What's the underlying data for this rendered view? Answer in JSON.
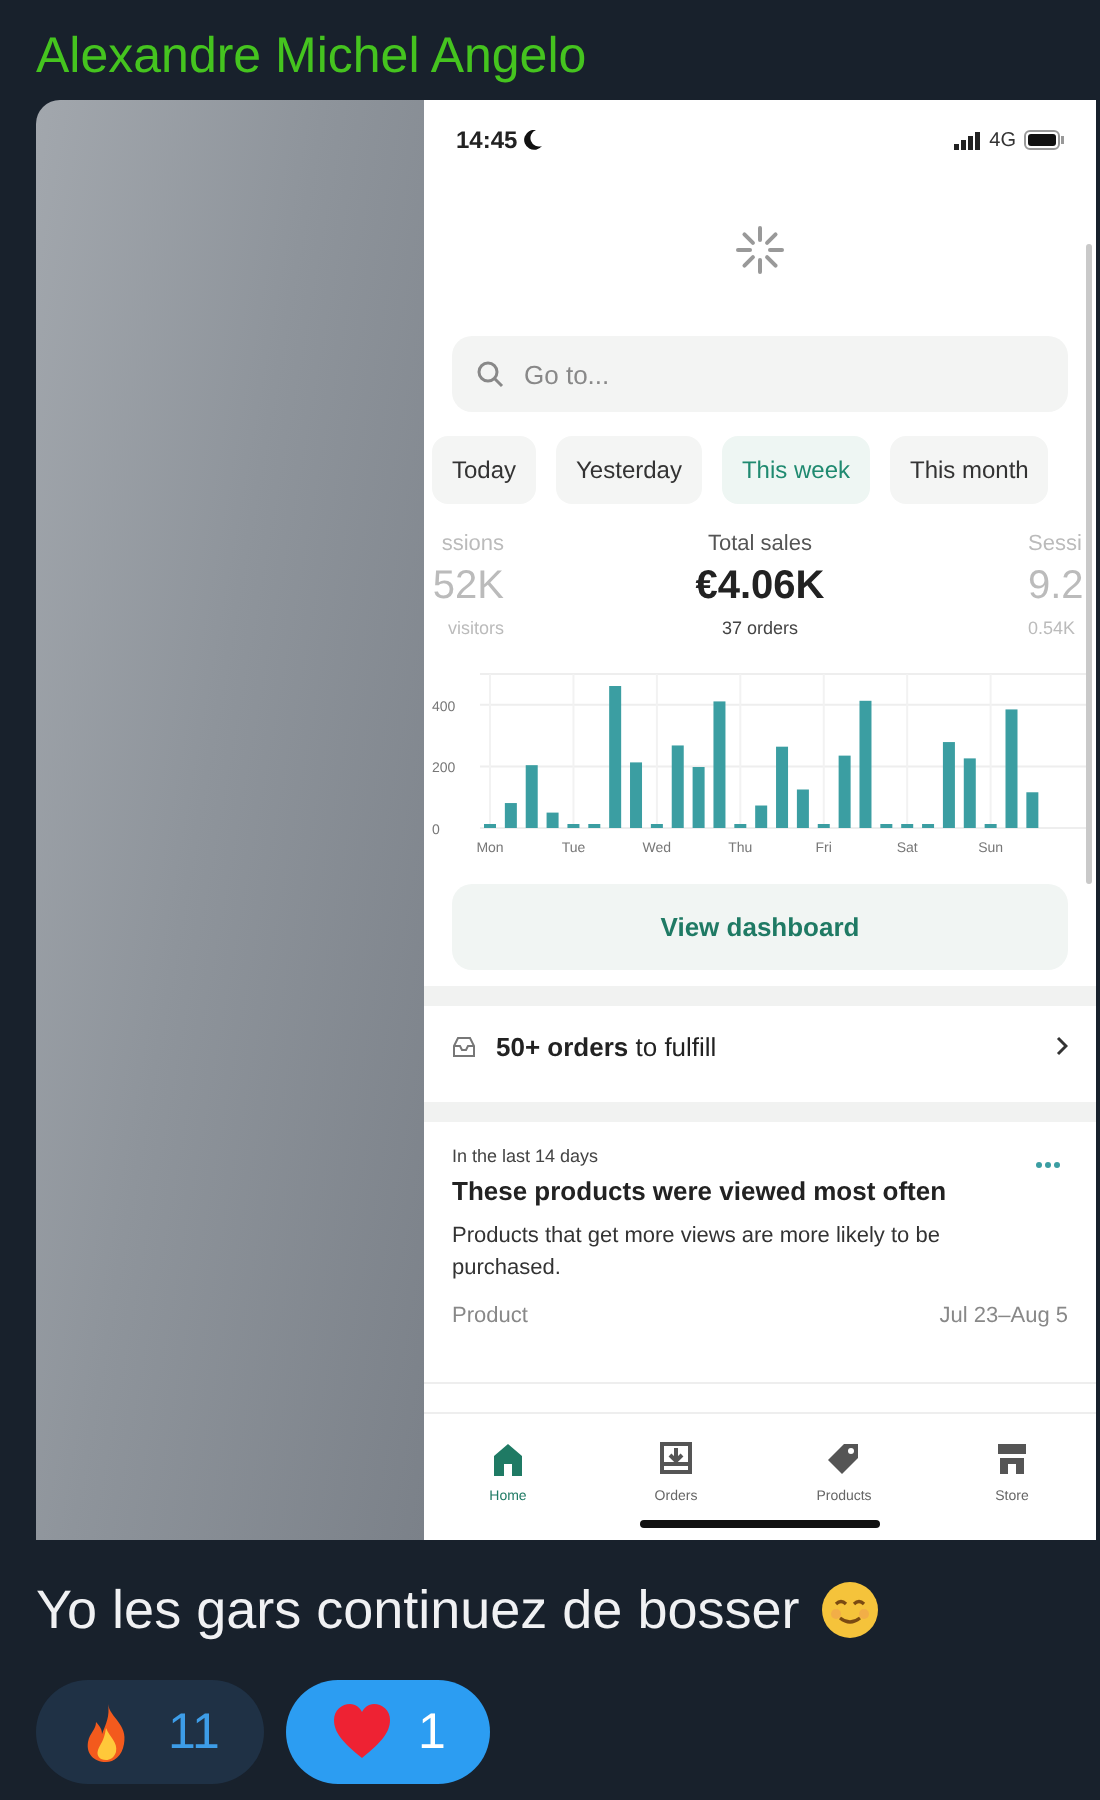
{
  "sender": {
    "name": "Alexandre Michel Angelo"
  },
  "screenshot": {
    "status_bar": {
      "time": "14:45",
      "network": "4G"
    },
    "search": {
      "placeholder": "Go to..."
    },
    "periods": [
      {
        "label": "Today",
        "selected": false
      },
      {
        "label": "Yesterday",
        "selected": false
      },
      {
        "label": "This week",
        "selected": true
      },
      {
        "label": "This month",
        "selected": false
      }
    ],
    "stats": [
      {
        "label": "ssions",
        "value": "52K",
        "detail": "visitors"
      },
      {
        "label": "Total sales",
        "value": "€4.06K",
        "detail": "37 orders"
      },
      {
        "label": "Sessi",
        "value": "9.2",
        "detail": "0.54K"
      }
    ],
    "chart_data": {
      "type": "bar",
      "categories": [
        "Mon",
        null,
        null,
        null,
        "Tue",
        null,
        null,
        null,
        "Wed",
        null,
        null,
        null,
        "Thu",
        null,
        null,
        null,
        "Fri",
        null,
        null,
        null,
        "Sat",
        null,
        null,
        null,
        "Sun",
        null,
        null
      ],
      "values": [
        0,
        81,
        204,
        50,
        0,
        0,
        461,
        213,
        0,
        268,
        198,
        411,
        0,
        73,
        264,
        125,
        0,
        235,
        413,
        0,
        0,
        0,
        279,
        226,
        0,
        385,
        116
      ],
      "ylim": [
        0,
        500
      ],
      "yticks": [
        0,
        200,
        400
      ],
      "grid": true
    },
    "dashboard_button": "View dashboard",
    "orders_row": "**50+ orders** to fulfill",
    "insight": {
      "eyebrow": "In the last 14 days",
      "title": "These products were viewed most often",
      "description": "Products that get more views are more likely to be purchased.",
      "column_1": "Product",
      "column_2": "Jul 23–Aug 5"
    },
    "nav": [
      {
        "label": "Home",
        "kind": "home",
        "selected": true
      },
      {
        "label": "Orders",
        "kind": "orders",
        "selected": false
      },
      {
        "label": "Products",
        "kind": "products",
        "selected": false
      },
      {
        "label": "Store",
        "kind": "store",
        "selected": false
      }
    ]
  },
  "message": {
    "text": "Yo les gars continuez de bosser"
  },
  "reactions": [
    {
      "kind": "fire",
      "count": "11",
      "selected": false
    },
    {
      "kind": "heart",
      "count": "1",
      "selected": true
    }
  ]
}
